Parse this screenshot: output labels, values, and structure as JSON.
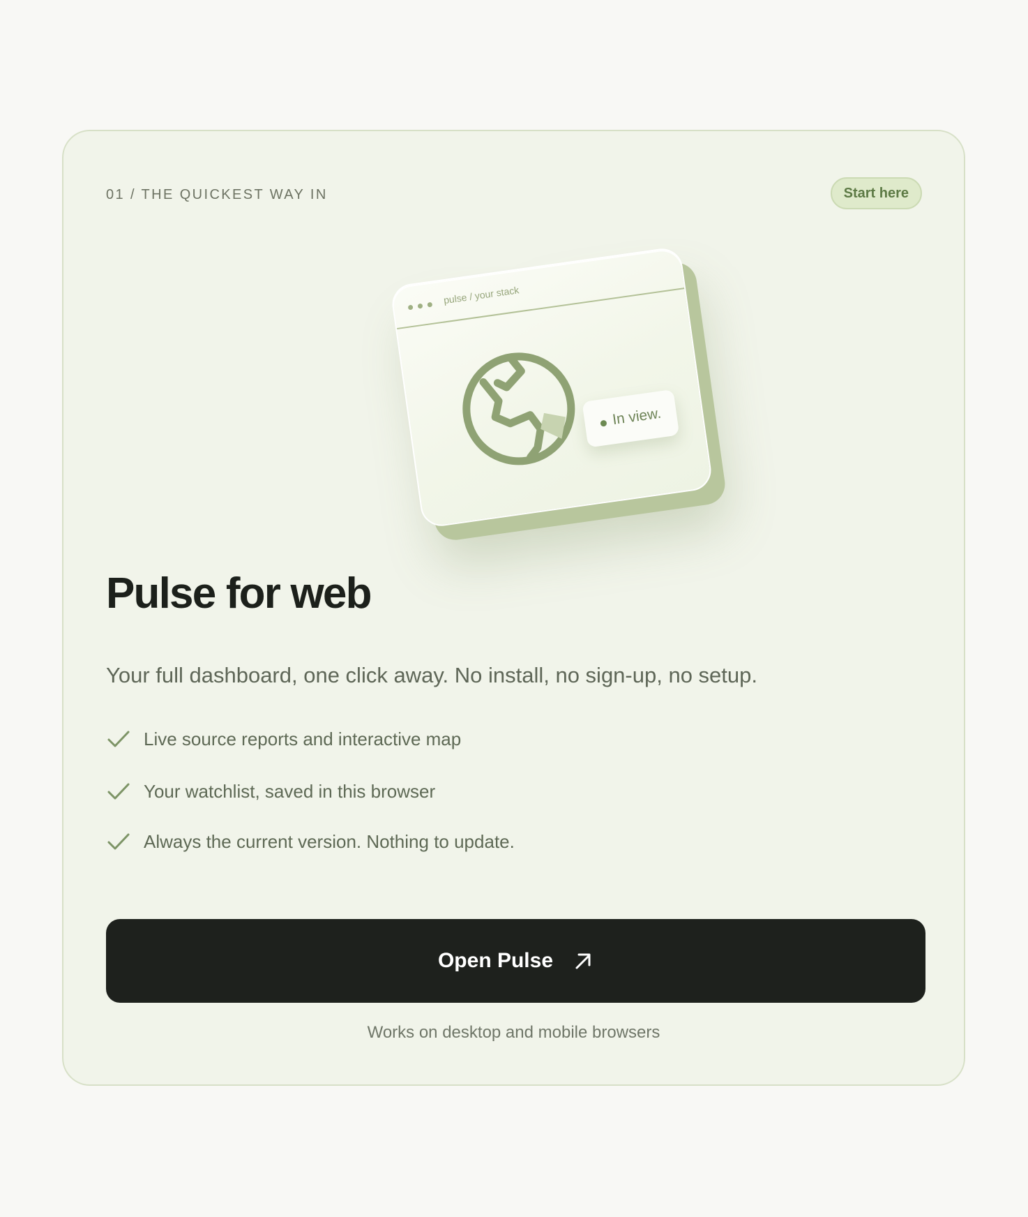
{
  "card": {
    "eyebrow": "01 / THE QUICKEST WAY IN",
    "badge": "Start here"
  },
  "illustration": {
    "window_title": "pulse / your stack",
    "status_chip": "In view.",
    "icon": "globe-icon"
  },
  "heading": "Pulse for web",
  "subtitle": "Your full dashboard, one click away. No install, no sign-up, no setup.",
  "features": [
    {
      "icon": "check-icon",
      "label": "Live source reports and interactive map"
    },
    {
      "icon": "check-icon",
      "label": "Your watchlist, saved in this browser"
    },
    {
      "icon": "check-icon",
      "label": "Always the current version. Nothing to update."
    }
  ],
  "cta": {
    "label": "Open Pulse",
    "icon": "arrow-up-right-icon"
  },
  "footnote": "Works on desktop and mobile browsers",
  "colors": {
    "page_background": "#f8f8f5",
    "card_background": "#f1f4ea",
    "card_border": "#d7e0c7",
    "accent_green": "#8fa274",
    "badge_background": "#dfeacb",
    "badge_text": "#5d7a45",
    "heading": "#1c201b",
    "button_background": "#1e211d",
    "button_text": "#ffffff"
  }
}
